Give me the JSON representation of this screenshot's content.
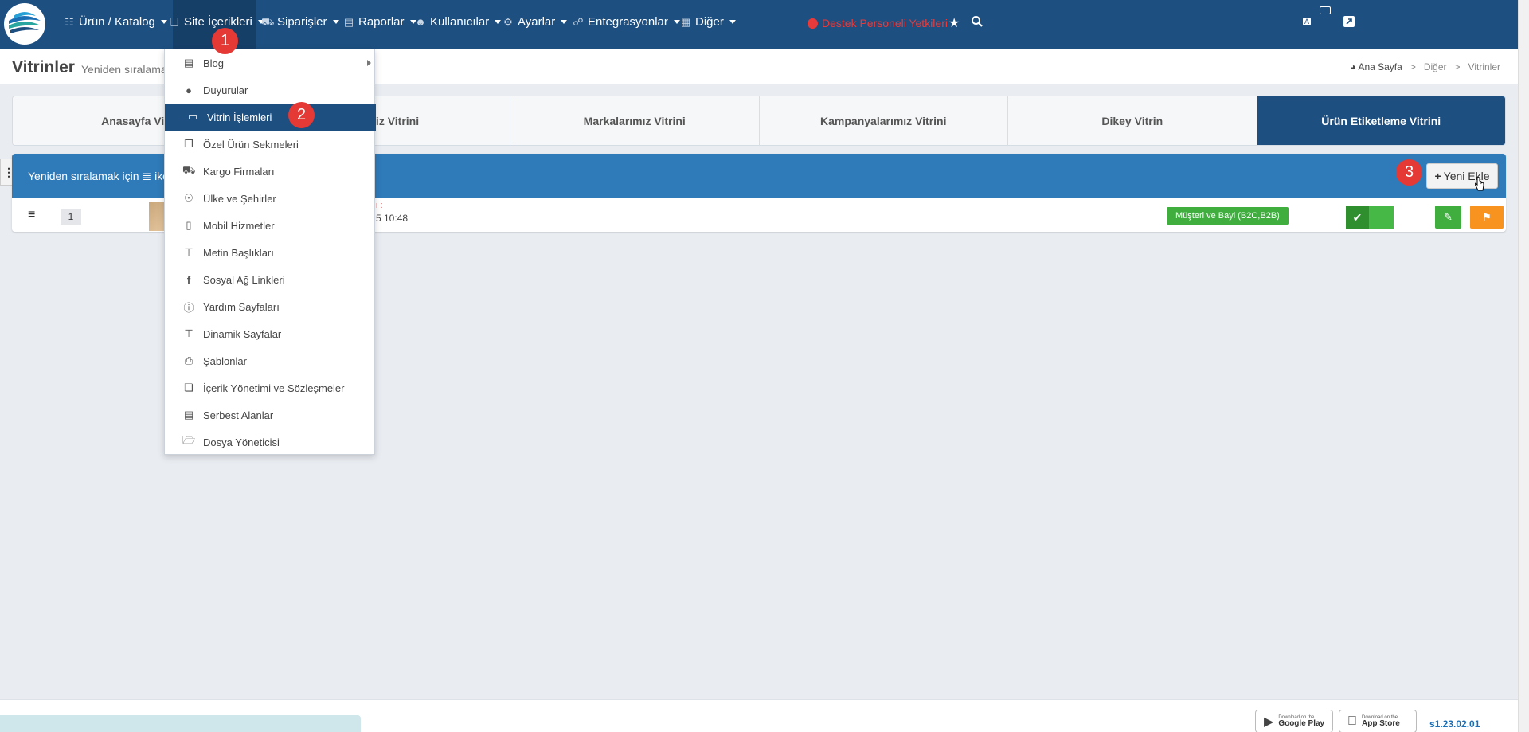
{
  "nav": {
    "items": [
      {
        "label": "Ürün / Katalog",
        "icon": "users-icon"
      },
      {
        "label": "Site İçerikleri",
        "icon": "copy-icon"
      },
      {
        "label": "Siparişler",
        "icon": "truck-icon"
      },
      {
        "label": "Raporlar",
        "icon": "file-icon"
      },
      {
        "label": "Kullanıcılar",
        "icon": "users-icon"
      },
      {
        "label": "Ayarlar",
        "icon": "cogs-icon"
      },
      {
        "label": "Entegrasyonlar",
        "icon": "sitemap-icon"
      },
      {
        "label": "Diğer",
        "icon": "grid-icon"
      }
    ],
    "support": "Destek Personeli Yetkileri"
  },
  "header": {
    "title": "Vitrinler",
    "subtitle": "Yeniden sıralama",
    "breadcrumb": [
      "Ana Sayfa",
      "Diğer",
      "Vitrinler"
    ]
  },
  "tabs": [
    "Anasayfa Vitr",
    "erimiz Vitrini",
    "Markalarımız Vitrini",
    "Kampanyalarımız Vitrini",
    "Dikey Vitrin",
    "Ürün Etiketleme Vitrini"
  ],
  "panel": {
    "head_text": "Yeniden sıralamak için ≣ ikon",
    "new_button": "Yeni Ekle",
    "row": {
      "order": "1",
      "label": "i :",
      "date": "5 10:48",
      "badge": "Müşteri ve Bayi (B2C,B2B)"
    }
  },
  "dropdown": [
    {
      "label": "Blog",
      "icon": "newspaper-icon",
      "submenu": true
    },
    {
      "label": "Duyurular",
      "icon": "comment-icon"
    },
    {
      "label": "Vitrin İşlemleri",
      "icon": "monitor-icon",
      "active": true
    },
    {
      "label": "Özel Ürün Sekmeleri",
      "icon": "window-icon"
    },
    {
      "label": "Kargo Firmaları",
      "icon": "truck-icon"
    },
    {
      "label": "Ülke ve Şehirler",
      "icon": "globe-icon"
    },
    {
      "label": "Mobil Hizmetler",
      "icon": "mobile-icon"
    },
    {
      "label": "Metin Başlıkları",
      "icon": "text-height-icon"
    },
    {
      "label": "Sosyal Ağ Linkleri",
      "icon": "facebook-icon"
    },
    {
      "label": "Yardım Sayfaları",
      "icon": "info-icon"
    },
    {
      "label": "Dinamik Sayfalar",
      "icon": "text-height-icon"
    },
    {
      "label": "Şablonlar",
      "icon": "print-icon"
    },
    {
      "label": "İçerik Yönetimi ve Sözleşmeler",
      "icon": "copy-icon"
    },
    {
      "label": "Serbest Alanlar",
      "icon": "file-icon"
    },
    {
      "label": "Dosya Yöneticisi",
      "icon": "folder-open-icon"
    }
  ],
  "steps": [
    "1",
    "2",
    "3"
  ],
  "footer": {
    "google_small": "Download on the",
    "google_big": "Google Play",
    "apple_small": "Download on the",
    "apple_big": "App Store",
    "version": "s1.23.02.01"
  }
}
